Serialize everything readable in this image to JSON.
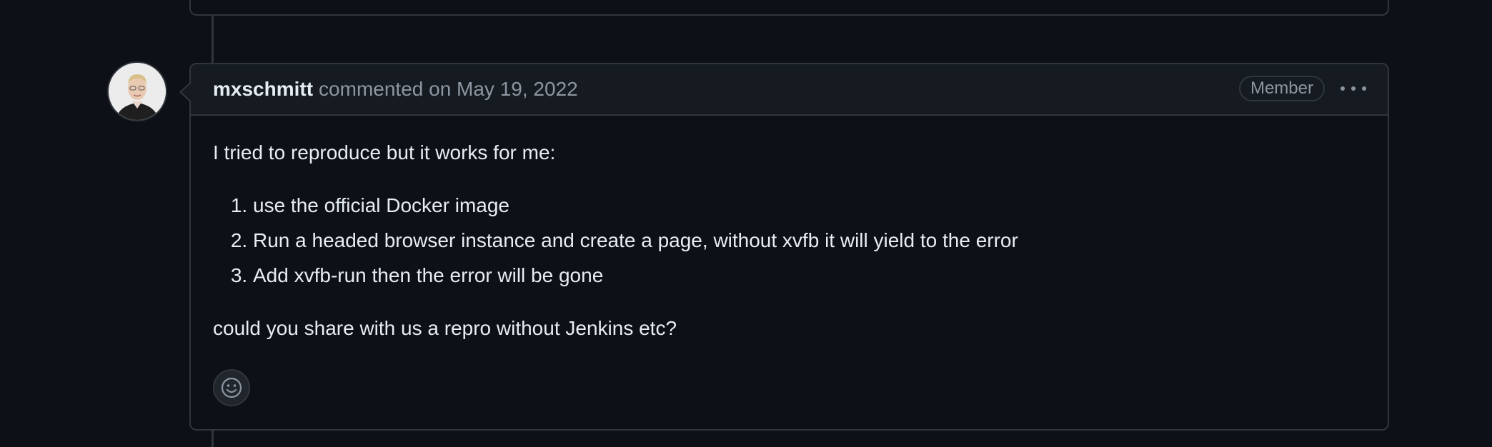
{
  "comment": {
    "author": "mxschmitt",
    "meta": "commented on May 19, 2022",
    "badge": "Member",
    "intro": "I tried to reproduce but it works for me:",
    "steps": [
      "use the official Docker image",
      "Run a headed browser instance and create a page, without xvfb it will yield to the error",
      "Add xvfb-run then the error will be gone"
    ],
    "outro": "could you share with us a repro without Jenkins etc?"
  },
  "icons": {
    "more": "kebab-horizontal-icon",
    "reaction": "smiley-icon"
  },
  "colors": {
    "background": "#0d1117",
    "header_bg": "#161b22",
    "border": "#30363d",
    "text": "#e6edf3",
    "muted": "#8d96a0"
  }
}
